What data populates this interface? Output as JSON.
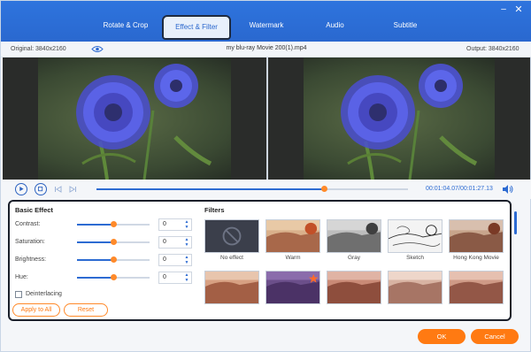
{
  "tabs": {
    "rotate": "Rotate & Crop",
    "effect": "Effect & Filter",
    "watermark": "Watermark",
    "audio": "Audio",
    "subtitle": "Subtitle"
  },
  "window": {
    "minimize": "–",
    "close": "✕"
  },
  "info": {
    "original": "Original: 3840x2160",
    "file_name": "my blu-ray Movie 200(1).mp4",
    "output": "Output: 3840x2160"
  },
  "playback": {
    "current_time": "00:01:04.07",
    "separator": "/",
    "total_time": "00:01:27.13",
    "progress": 0.73
  },
  "basic_effect": {
    "title": "Basic Effect",
    "sliders": [
      {
        "label": "Contrast:",
        "value": "0",
        "level": 0.5
      },
      {
        "label": "Saturation:",
        "value": "0",
        "level": 0.5
      },
      {
        "label": "Brightness:",
        "value": "0",
        "level": 0.5
      },
      {
        "label": "Hue:",
        "value": "0",
        "level": 0.5
      }
    ],
    "deinterlacing": "Deinterlacing",
    "apply_all": "Apply to All",
    "reset": "Reset"
  },
  "filters": {
    "title": "Filters",
    "items": [
      {
        "label": "No effect"
      },
      {
        "label": "Warm"
      },
      {
        "label": "Gray"
      },
      {
        "label": "Sketch"
      },
      {
        "label": "Hong Kong Movie"
      },
      {
        "label": ""
      },
      {
        "label": ""
      },
      {
        "label": ""
      },
      {
        "label": ""
      },
      {
        "label": ""
      }
    ]
  },
  "footer": {
    "ok": "OK",
    "cancel": "Cancel"
  },
  "colors": {
    "accent": "#2b6fd8",
    "orange": "#ff7a12",
    "panel_border": "#1a1f2a"
  }
}
